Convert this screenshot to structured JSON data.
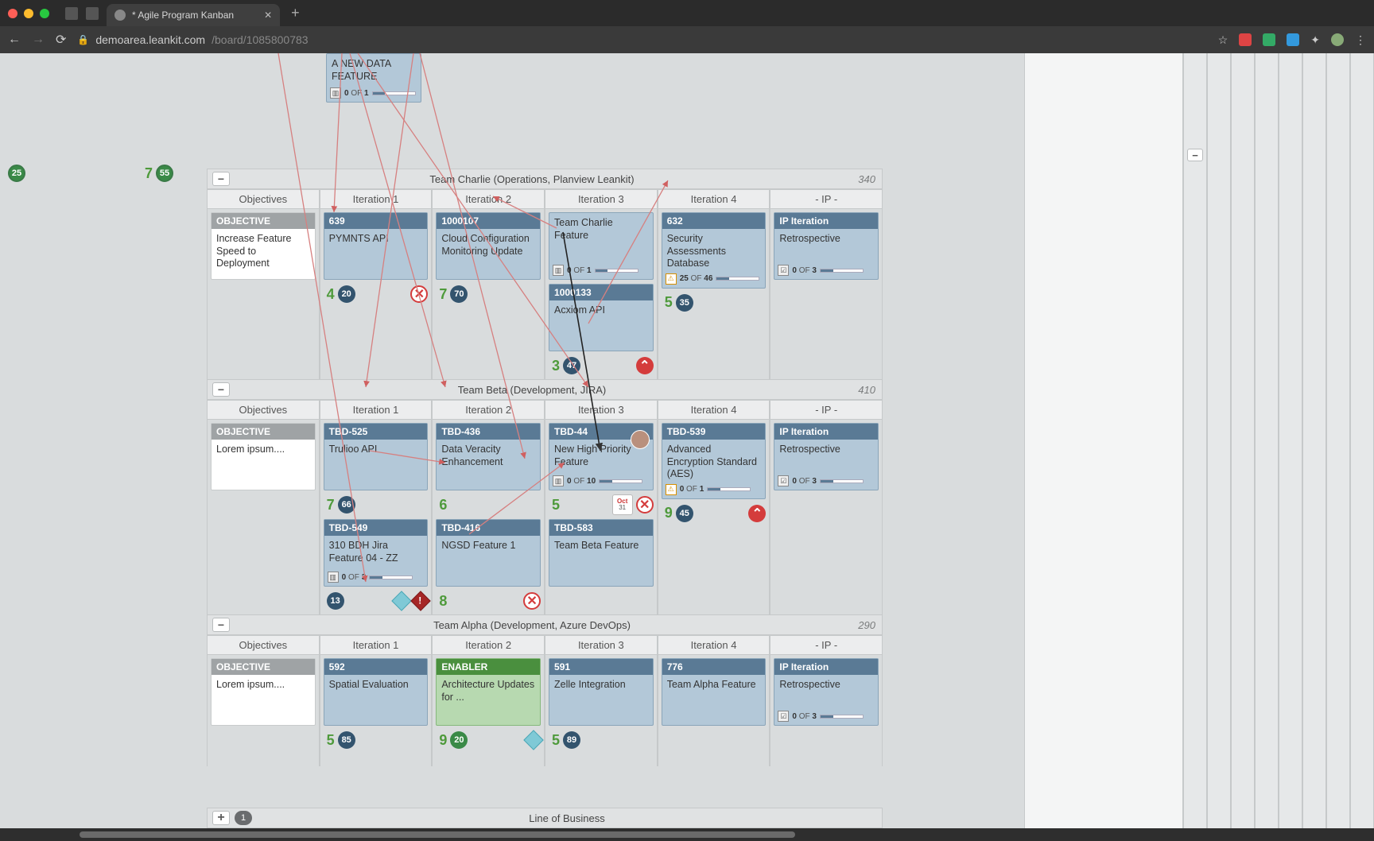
{
  "browser": {
    "tab_title": "* Agile Program Kanban",
    "url_domain": "demoarea.leankit.com",
    "url_path": "/board/1085800783"
  },
  "top_badges": [
    {
      "score": "",
      "circ": "25"
    },
    {
      "score": "7",
      "circ": "55"
    }
  ],
  "partial_card": {
    "body": "A NEW DATA FEATURE",
    "progress_current": 0,
    "progress_total": 1
  },
  "lanes": [
    {
      "title": "Team Charlie (Operations, Planview Leankit)",
      "count": "340",
      "columns": [
        "Objectives",
        "Iteration 1",
        "Iteration 2",
        "Iteration 3",
        "Iteration 4",
        "- IP -"
      ],
      "cells": {
        "objectives": [
          {
            "hdr": "OBJECTIVE",
            "body": "Increase Feature Speed to Deployment",
            "type": "objective"
          }
        ],
        "i1": [
          {
            "hdr": "639",
            "body": "PYMNTS API",
            "below": {
              "score": "4",
              "circ": "20",
              "circColor": "navy",
              "xred": true,
              "xredRight": true
            }
          }
        ],
        "i2": [
          {
            "hdr": "1000107",
            "body": "Cloud Configuration Monitoring Update",
            "below": {
              "score": "7",
              "circ": "70",
              "circColor": "navy"
            }
          }
        ],
        "i3": [
          {
            "hdr": "",
            "body": "Team Charlie Feature",
            "mini": {
              "cur": 0,
              "tot": 1,
              "icon": "chart"
            }
          },
          {
            "hdr": "1000133",
            "body": "Acxiom API",
            "below": {
              "score": "3",
              "circ": "47",
              "circColor": "navy",
              "chev": true,
              "chevRight": true
            }
          }
        ],
        "i4": [
          {
            "hdr": "632",
            "body": "Security Assessments Database",
            "mini": {
              "cur": 25,
              "tot": 46,
              "icon": "warn"
            },
            "below": {
              "score": "5",
              "circ": "35",
              "circColor": "navy"
            }
          }
        ],
        "ip": [
          {
            "hdr": "IP Iteration",
            "body": "Retrospective",
            "mini": {
              "cur": 0,
              "tot": 3,
              "icon": "check"
            }
          }
        ]
      }
    },
    {
      "title": "Team Beta (Development, JIRA)",
      "count": "410",
      "columns": [
        "Objectives",
        "Iteration 1",
        "Iteration 2",
        "Iteration 3",
        "Iteration 4",
        "- IP -"
      ],
      "cells": {
        "objectives": [
          {
            "hdr": "OBJECTIVE",
            "body": "Lorem ipsum....",
            "type": "objective"
          }
        ],
        "i1": [
          {
            "hdr": "TBD-525",
            "body": "Trulioo API",
            "below": {
              "score": "7",
              "circ": "66",
              "circColor": "navy"
            }
          },
          {
            "hdr": "TBD-549",
            "body": "310 BDH Jira Feature 04 - ZZ",
            "mini": {
              "cur": 0,
              "tot": 3,
              "icon": "chart"
            },
            "below": {
              "circ": "13",
              "circColor": "navy",
              "diamonds": true
            }
          }
        ],
        "i2": [
          {
            "hdr": "TBD-436",
            "body": "Data Veracity Enhancement",
            "below": {
              "score": "6"
            }
          },
          {
            "hdr": "TBD-416",
            "body": "NGSD Feature 1",
            "below": {
              "score": "8",
              "xred": true,
              "xredRight": true
            }
          }
        ],
        "i3": [
          {
            "hdr": "TBD-44",
            "body": "New High Priority Feature",
            "avatar": true,
            "mini": {
              "cur": 0,
              "tot": 10,
              "icon": "chart"
            },
            "below": {
              "score": "5",
              "date": {
                "m": "Oct",
                "d": "31"
              },
              "xred": true
            }
          },
          {
            "hdr": "TBD-583",
            "body": "Team Beta Feature"
          }
        ],
        "i4": [
          {
            "hdr": "TBD-539",
            "body": "Advanced Encryption Standard (AES)",
            "mini": {
              "cur": 0,
              "tot": 1,
              "icon": "warn"
            },
            "below": {
              "score": "9",
              "circ": "45",
              "circColor": "navy",
              "chev": true,
              "chevRight": true
            }
          }
        ],
        "ip": [
          {
            "hdr": "IP Iteration",
            "body": "Retrospective",
            "mini": {
              "cur": 0,
              "tot": 3,
              "icon": "check"
            }
          }
        ]
      }
    },
    {
      "title": "Team Alpha (Development, Azure DevOps)",
      "count": "290",
      "columns": [
        "Objectives",
        "Iteration 1",
        "Iteration 2",
        "Iteration 3",
        "Iteration 4",
        "- IP -"
      ],
      "cells": {
        "objectives": [
          {
            "hdr": "OBJECTIVE",
            "body": "Lorem ipsum....",
            "type": "objective"
          }
        ],
        "i1": [
          {
            "hdr": "592",
            "body": "Spatial Evaluation",
            "below": {
              "score": "5",
              "circ": "85",
              "circColor": "navy"
            }
          }
        ],
        "i2": [
          {
            "hdr": "ENABLER",
            "body": "Architecture Updates for ...",
            "type": "enabler",
            "below": {
              "score": "9",
              "circ": "20",
              "circColor": "green",
              "diamond1": true
            }
          }
        ],
        "i3": [
          {
            "hdr": "591",
            "body": "Zelle Integration",
            "below": {
              "score": "5",
              "circ": "89",
              "circColor": "navy"
            }
          }
        ],
        "i4": [
          {
            "hdr": "776",
            "body": "Team Alpha Feature"
          }
        ],
        "ip": [
          {
            "hdr": "IP Iteration",
            "body": "Retrospective",
            "mini": {
              "cur": 0,
              "tot": 3,
              "icon": "check"
            }
          }
        ]
      }
    }
  ],
  "bottom_lane": {
    "title": "Line of Business",
    "count": "1"
  }
}
